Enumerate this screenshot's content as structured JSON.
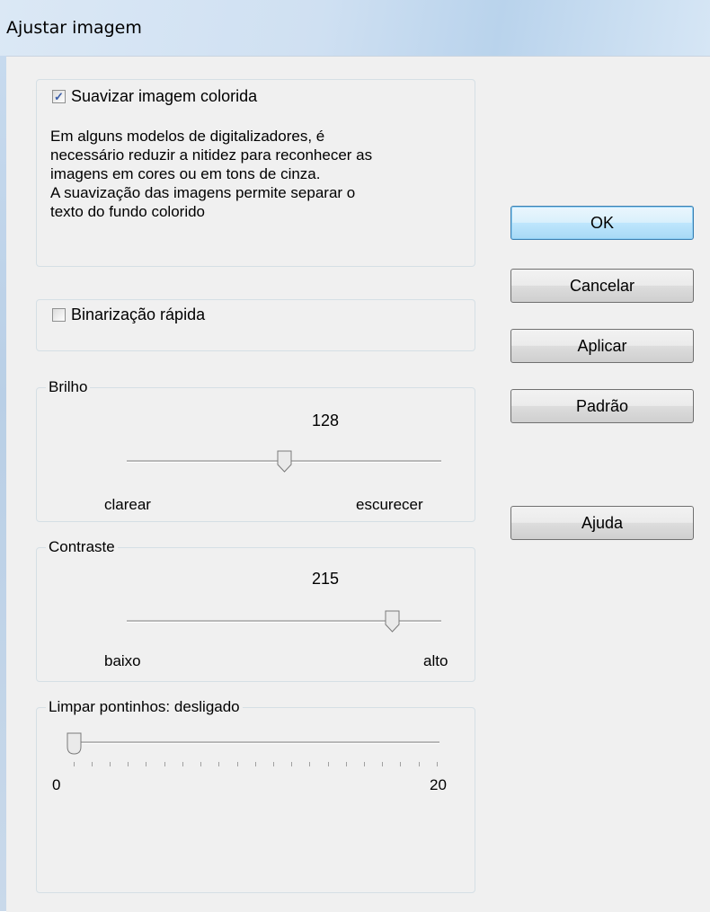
{
  "window": {
    "title": "Ajustar imagem"
  },
  "smooth": {
    "checkbox_label": "Suavizar imagem colorida",
    "checked": true,
    "description_lines": [
      "Em alguns modelos de digitalizadores, é",
      "necessário reduzir a nitidez para reconhecer as",
      "imagens em cores ou em tons de cinza.",
      "A suavização das imagens permite separar o",
      "texto do fundo colorido"
    ]
  },
  "binarization": {
    "checkbox_label": "Binarização rápida",
    "checked": false
  },
  "brightness": {
    "legend": "Brilho",
    "value": "128",
    "min_label": "clarear",
    "max_label": "escurecer",
    "level": 0.5
  },
  "contrast": {
    "legend": "Contraste",
    "value": "215",
    "min_label": "baixo",
    "max_label": "alto",
    "level": 0.84
  },
  "despeckle": {
    "legend": "Limpar pontinhos: desligado",
    "min_label": "0",
    "max_label": "20",
    "level": 0
  },
  "buttons": {
    "ok": "OK",
    "cancel": "Cancelar",
    "apply": "Aplicar",
    "default": "Padrão",
    "help": "Ajuda"
  }
}
